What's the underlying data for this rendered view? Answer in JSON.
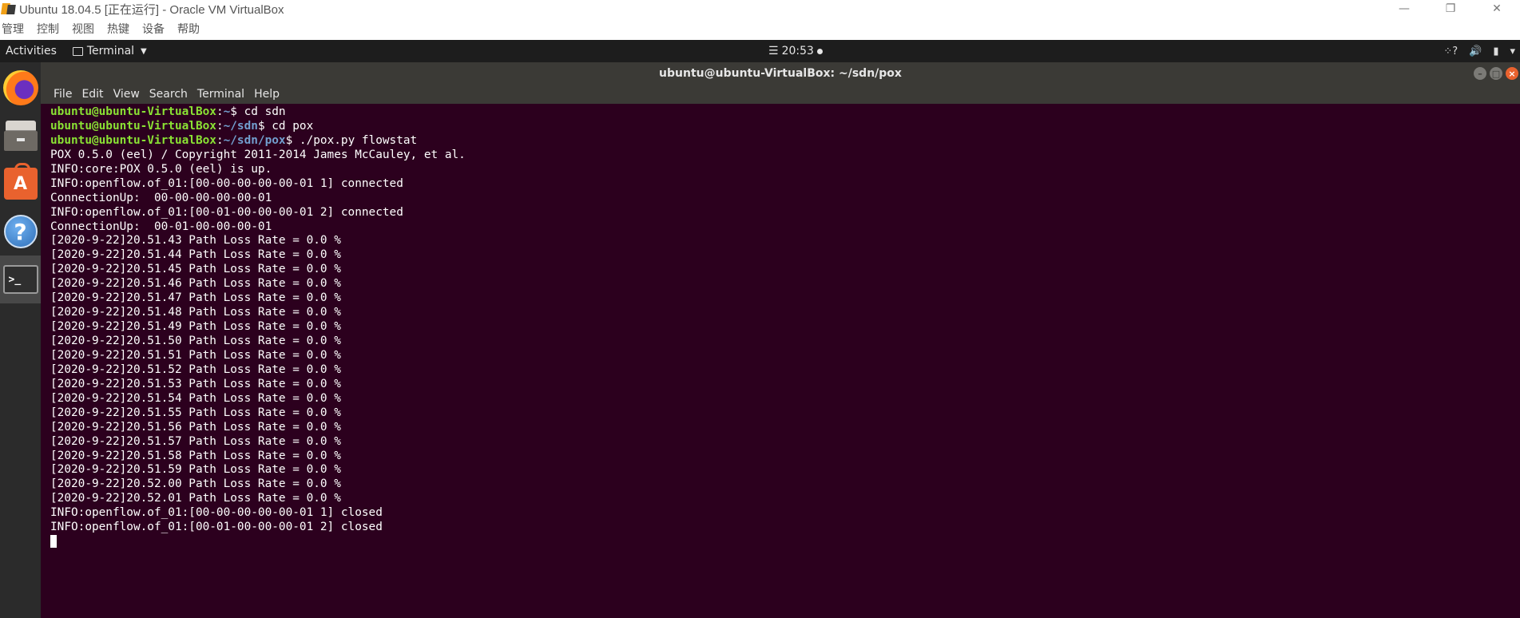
{
  "vbox": {
    "title": "Ubuntu 18.04.5 [正在运行] - Oracle VM VirtualBox",
    "menu": [
      "管理",
      "控制",
      "视图",
      "热键",
      "设备",
      "帮助"
    ],
    "controls": {
      "minimize": "—",
      "restore": "❐",
      "close": "✕"
    }
  },
  "topbar": {
    "activities": "Activities",
    "app_name": "Terminal",
    "clock": "20:53",
    "tray_icons": [
      "network-icon",
      "volume-icon",
      "battery-icon",
      "chevron-down-icon"
    ]
  },
  "dock": {
    "items": [
      "firefox-icon",
      "files-icon",
      "software-icon",
      "help-icon",
      "terminal-icon"
    ],
    "active": "terminal-icon"
  },
  "terminal": {
    "title": "ubuntu@ubuntu-VirtualBox: ~/sdn/pox",
    "menu": [
      "File",
      "Edit",
      "View",
      "Search",
      "Terminal",
      "Help"
    ],
    "prompts": [
      {
        "user": "ubuntu@ubuntu-VirtualBox",
        "path": "~",
        "cmd": " cd sdn"
      },
      {
        "user": "ubuntu@ubuntu-VirtualBox",
        "path": "~/sdn",
        "cmd": " cd pox"
      },
      {
        "user": "ubuntu@ubuntu-VirtualBox",
        "path": "~/sdn/pox",
        "cmd": " ./pox.py flowstat"
      }
    ],
    "output": [
      "POX 0.5.0 (eel) / Copyright 2011-2014 James McCauley, et al.",
      "INFO:core:POX 0.5.0 (eel) is up.",
      "INFO:openflow.of_01:[00-00-00-00-00-01 1] connected",
      "ConnectionUp:  00-00-00-00-00-01",
      "INFO:openflow.of_01:[00-01-00-00-00-01 2] connected",
      "ConnectionUp:  00-01-00-00-00-01",
      "[2020-9-22]20.51.43 Path Loss Rate = 0.0 %",
      "[2020-9-22]20.51.44 Path Loss Rate = 0.0 %",
      "[2020-9-22]20.51.45 Path Loss Rate = 0.0 %",
      "[2020-9-22]20.51.46 Path Loss Rate = 0.0 %",
      "[2020-9-22]20.51.47 Path Loss Rate = 0.0 %",
      "[2020-9-22]20.51.48 Path Loss Rate = 0.0 %",
      "[2020-9-22]20.51.49 Path Loss Rate = 0.0 %",
      "[2020-9-22]20.51.50 Path Loss Rate = 0.0 %",
      "[2020-9-22]20.51.51 Path Loss Rate = 0.0 %",
      "[2020-9-22]20.51.52 Path Loss Rate = 0.0 %",
      "[2020-9-22]20.51.53 Path Loss Rate = 0.0 %",
      "[2020-9-22]20.51.54 Path Loss Rate = 0.0 %",
      "[2020-9-22]20.51.55 Path Loss Rate = 0.0 %",
      "[2020-9-22]20.51.56 Path Loss Rate = 0.0 %",
      "[2020-9-22]20.51.57 Path Loss Rate = 0.0 %",
      "[2020-9-22]20.51.58 Path Loss Rate = 0.0 %",
      "[2020-9-22]20.51.59 Path Loss Rate = 0.0 %",
      "[2020-9-22]20.52.00 Path Loss Rate = 0.0 %",
      "[2020-9-22]20.52.01 Path Loss Rate = 0.0 %",
      "INFO:openflow.of_01:[00-00-00-00-00-01 1] closed",
      "INFO:openflow.of_01:[00-01-00-00-00-01 2] closed"
    ],
    "colors": {
      "background": "#2c001e",
      "user": "#8ae234",
      "path": "#729fcf",
      "text": "#ffffff"
    }
  }
}
